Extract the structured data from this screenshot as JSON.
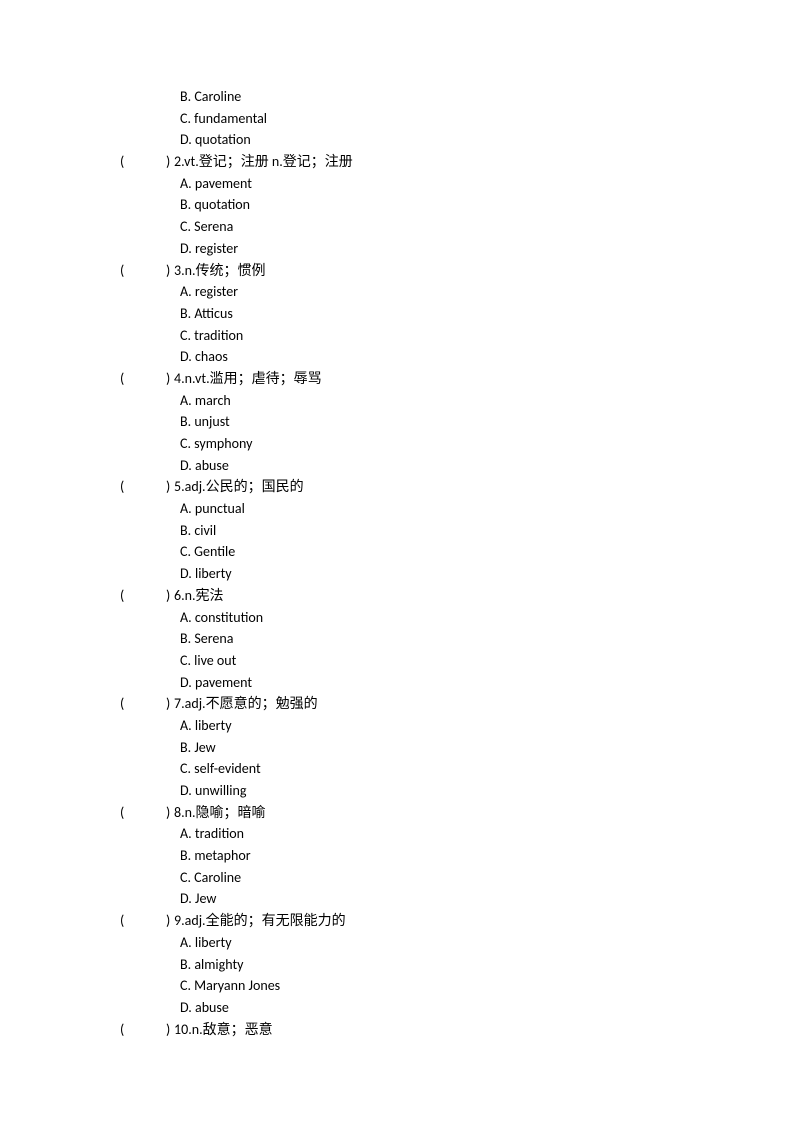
{
  "orphan_options": [
    "B. Caroline",
    "C. fundamental",
    "D. quotation"
  ],
  "questions": [
    {
      "num": "2",
      "prompt": ".vt.登记；注册  n.登记；注册",
      "options": [
        "A. pavement",
        "B. quotation",
        "C. Serena",
        "D. register"
      ]
    },
    {
      "num": "3",
      "prompt": ".n.传统；惯例",
      "options": [
        "A. register",
        "B. Atticus",
        "C. tradition",
        "D. chaos"
      ]
    },
    {
      "num": "4",
      "prompt": ".n.vt.滥用；虐待；辱骂",
      "options": [
        "A. march",
        "B. unjust",
        "C. symphony",
        "D. abuse"
      ]
    },
    {
      "num": "5",
      "prompt": ".adj.公民的；国民的",
      "options": [
        "A. punctual",
        "B. civil",
        "C. Gentile",
        "D. liberty"
      ]
    },
    {
      "num": "6",
      "prompt": ".n.宪法",
      "options": [
        "A. constitution",
        "B. Serena",
        "C. live out",
        "D. pavement"
      ]
    },
    {
      "num": "7",
      "prompt": ".adj.不愿意的；勉强的",
      "options": [
        "A. liberty",
        "B. Jew",
        "C. self-evident",
        "D. unwilling"
      ]
    },
    {
      "num": "8",
      "prompt": ".n.隐喻；暗喻",
      "options": [
        "A. tradition",
        "B. metaphor",
        "C. Caroline",
        "D. Jew"
      ]
    },
    {
      "num": "9",
      "prompt": ".adj.全能的；有无限能力的",
      "options": [
        "A. liberty",
        "B. almighty",
        "C. Maryann Jones",
        "D. abuse"
      ]
    },
    {
      "num": "10",
      "prompt": ".n.敌意；恶意",
      "options": []
    }
  ],
  "paren_left": "(",
  "paren_right": ")"
}
